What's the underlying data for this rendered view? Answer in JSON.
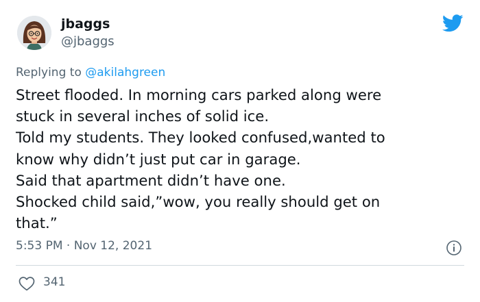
{
  "tweet": {
    "author": {
      "display_name": "jbaggs",
      "handle": "@jbaggs",
      "avatar": "bitmoji-avatar"
    },
    "platform_icon": "twitter-bird-icon",
    "brand_color": "#1d9bf0",
    "reply": {
      "prefix": "Replying to",
      "to": "@akilahgreen"
    },
    "text_lines": [
      "Street flooded. In morning cars parked along were",
      "stuck in several inches of solid ice.",
      "Told my students. They looked confused,wanted to",
      "know why didn’t just put car in garage.",
      "Said that apartment didn’t have one.",
      "Shocked child said,”wow, you really should get on",
      "that.”"
    ],
    "time": "5:53 PM",
    "separator": "·",
    "date": "Nov 12, 2021",
    "info_icon": "info-icon",
    "like_icon": "heart-icon",
    "likes": "341"
  }
}
